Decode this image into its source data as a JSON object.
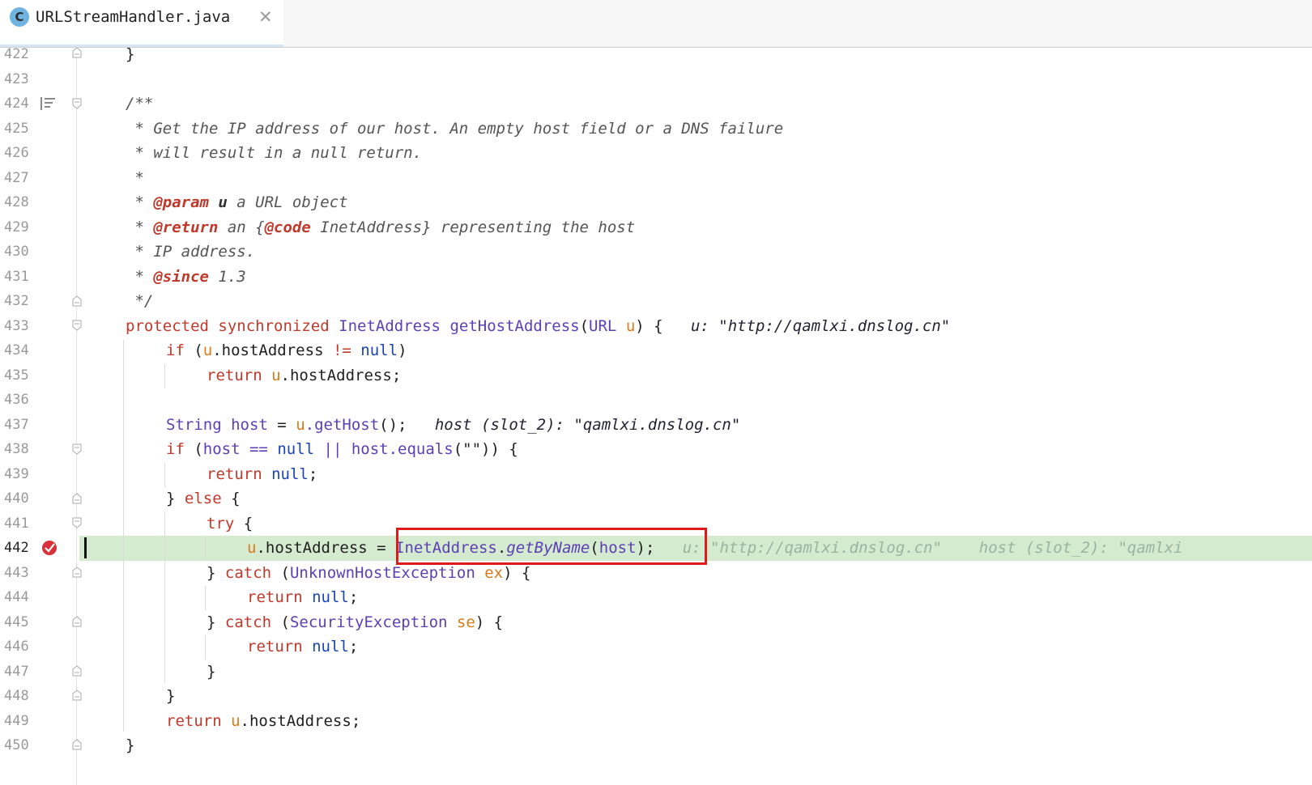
{
  "tab": {
    "icon_letter": "C",
    "title": "URLStreamHandler.java",
    "close_glyph": "✕"
  },
  "lines": [
    {
      "num": "422"
    },
    {
      "num": "423"
    },
    {
      "num": "424"
    },
    {
      "num": "425"
    },
    {
      "num": "426"
    },
    {
      "num": "427"
    },
    {
      "num": "428"
    },
    {
      "num": "429"
    },
    {
      "num": "430"
    },
    {
      "num": "431"
    },
    {
      "num": "432"
    },
    {
      "num": "433"
    },
    {
      "num": "434"
    },
    {
      "num": "435"
    },
    {
      "num": "436"
    },
    {
      "num": "437"
    },
    {
      "num": "438"
    },
    {
      "num": "439"
    },
    {
      "num": "440"
    },
    {
      "num": "441"
    },
    {
      "num": "442"
    },
    {
      "num": "443"
    },
    {
      "num": "444"
    },
    {
      "num": "445"
    },
    {
      "num": "446"
    },
    {
      "num": "447"
    },
    {
      "num": "448"
    },
    {
      "num": "449"
    },
    {
      "num": "450"
    }
  ],
  "code": {
    "l422": "}",
    "l424": "/**",
    "l425": " * Get the IP address of our host. An empty host field or a DNS failure",
    "l426": " * will result in a null return.",
    "l427": " *",
    "l428_pre": " * ",
    "l428_tag": "@param",
    "l428_u": " u",
    "l428_rest": " a URL object",
    "l429_pre": " * ",
    "l429_tag": "@return",
    "l429_mid": " an {",
    "l429_code": "@code",
    "l429_rest": " InetAddress} representing the host",
    "l430": " * IP address.",
    "l431_pre": " * ",
    "l431_tag": "@since",
    "l431_rest": " 1.3",
    "l432": " */",
    "l433_kw1": "protected",
    "l433_kw2": "synchronized",
    "l433_type": "InetAddress",
    "l433_method": "getHostAddress",
    "l433_p1": "(",
    "l433_ptype": "URL",
    "l433_pname": "u",
    "l433_end": ") {",
    "l433_hint": "u: \"http://qamlxi.dnslog.cn\"",
    "l434_kw": "if",
    "l434_a": " (",
    "l434_u": "u",
    "l434_b": ".hostAddress ",
    "l434_op": "!=",
    "l434_null": "null",
    "l434_c": ")",
    "l435_kw": "return",
    "l435_u": "u",
    "l435_rest": ".hostAddress;",
    "l437_type": "String",
    "l437_var": "host",
    "l437_eq": " = ",
    "l437_u": "u",
    "l437_m": ".getHost",
    "l437_end": "();",
    "l437_hint": "host (slot_2): \"qamlxi.dnslog.cn\"",
    "l438_kw": "if",
    "l438_a": " (",
    "l438_host": "host",
    "l438_op": " == ",
    "l438_null": "null",
    "l438_or": " || ",
    "l438_host2": "host",
    "l438_m": ".equals",
    "l438_end": "(\"\")) {",
    "l439_kw": "return",
    "l439_null": "null",
    "l439_end": ";",
    "l440_a": "} ",
    "l440_kw": "else",
    "l440_b": " {",
    "l441_kw": "try",
    "l441_b": " {",
    "l442_u": "u",
    "l442_a": ".hostAddress = ",
    "l442_type": "InetAddress",
    "l442_dot": ".",
    "l442_m": "getByName",
    "l442_p": "(",
    "l442_host": "host",
    "l442_end": ");",
    "l442_hint": "u: \"http://qamlxi.dnslog.cn\"    host (slot_2): \"qamlxi",
    "l443_a": "} ",
    "l443_kw": "catch",
    "l443_p": " (",
    "l443_type": "UnknownHostException",
    "l443_var": "ex",
    "l443_end": ") {",
    "l444_kw": "return",
    "l444_null": "null",
    "l444_end": ";",
    "l445_a": "} ",
    "l445_kw": "catch",
    "l445_p": " (",
    "l445_type": "SecurityException",
    "l445_var": "se",
    "l445_end": ") {",
    "l446_kw": "return",
    "l446_null": "null",
    "l446_end": ";",
    "l447": "}",
    "l448": "}",
    "l449_kw": "return",
    "l449_u": "u",
    "l449_rest": ".hostAddress;",
    "l450": "}"
  },
  "colors": {
    "current_line": "#d5ebd0",
    "highlight_box": "#e01a1a",
    "keyword": "#c0392b",
    "type": "#5c3fb5",
    "parameter": "#d97b1a"
  },
  "icons": {
    "tab": "java-class-icon",
    "breakpoint": "breakpoint-icon",
    "doc": "rendered-doc-icon"
  }
}
